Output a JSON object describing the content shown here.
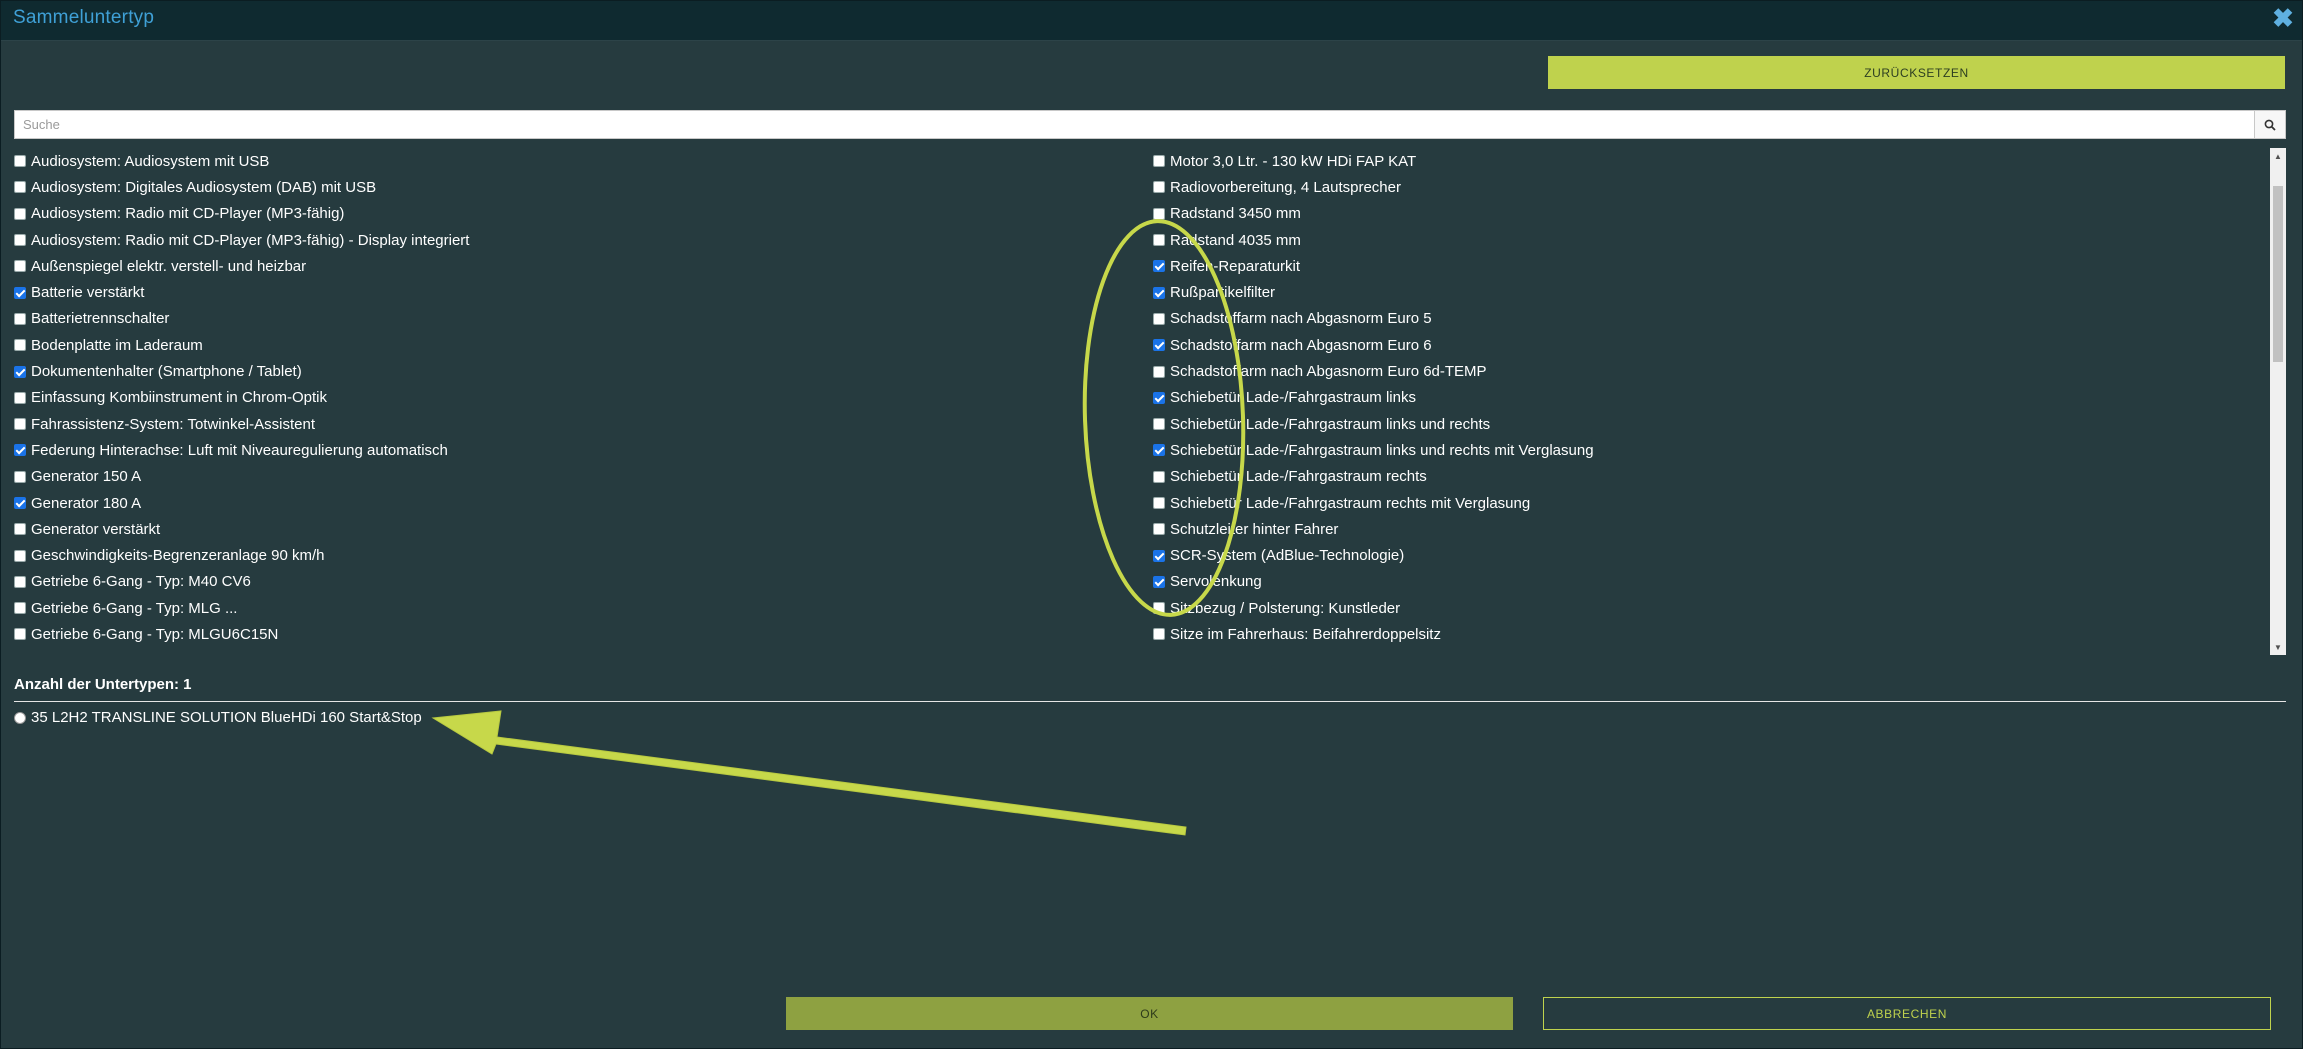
{
  "dialog": {
    "title": "Sammeluntertyp"
  },
  "toolbar": {
    "reset_label": "ZURÜCKSETZEN"
  },
  "search": {
    "placeholder": "Suche",
    "value": ""
  },
  "options_left": [
    {
      "label": "Audiosystem: Audiosystem mit USB",
      "checked": false
    },
    {
      "label": "Audiosystem: Digitales Audiosystem (DAB) mit USB",
      "checked": false
    },
    {
      "label": "Audiosystem: Radio mit CD-Player (MP3-fähig)",
      "checked": false
    },
    {
      "label": "Audiosystem: Radio mit CD-Player (MP3-fähig) - Display integriert",
      "checked": false
    },
    {
      "label": "Außenspiegel elektr. verstell- und heizbar",
      "checked": false
    },
    {
      "label": "Batterie verstärkt",
      "checked": true
    },
    {
      "label": "Batterietrennschalter",
      "checked": false
    },
    {
      "label": "Bodenplatte im Laderaum",
      "checked": false
    },
    {
      "label": "Dokumentenhalter (Smartphone / Tablet)",
      "checked": true
    },
    {
      "label": "Einfassung Kombiinstrument in Chrom-Optik",
      "checked": false
    },
    {
      "label": "Fahrassistenz-System: Totwinkel-Assistent",
      "checked": false
    },
    {
      "label": "Federung Hinterachse: Luft mit Niveauregulierung automatisch",
      "checked": true
    },
    {
      "label": "Generator 150 A",
      "checked": false
    },
    {
      "label": "Generator 180 A",
      "checked": true
    },
    {
      "label": "Generator verstärkt",
      "checked": false
    },
    {
      "label": "Geschwindigkeits-Begrenzeranlage 90 km/h",
      "checked": false
    },
    {
      "label": "Getriebe 6-Gang - Typ: M40 CV6",
      "checked": false
    },
    {
      "label": "Getriebe 6-Gang - Typ: MLG ...",
      "checked": false
    },
    {
      "label": "Getriebe 6-Gang - Typ: MLGU6C15N",
      "checked": false
    }
  ],
  "options_right": [
    {
      "label": "Motor 3,0 Ltr. - 130 kW HDi FAP KAT",
      "checked": false
    },
    {
      "label": "Radiovorbereitung, 4 Lautsprecher",
      "checked": false
    },
    {
      "label": "Radstand 3450 mm",
      "checked": false
    },
    {
      "label": "Radstand 4035 mm",
      "checked": false
    },
    {
      "label": "Reifen-Reparaturkit",
      "checked": true
    },
    {
      "label": "Rußpartikelfilter",
      "checked": true
    },
    {
      "label": "Schadstoffarm nach Abgasnorm Euro 5",
      "checked": false
    },
    {
      "label": "Schadstoffarm nach Abgasnorm Euro 6",
      "checked": true
    },
    {
      "label": "Schadstoffarm nach Abgasnorm Euro 6d-TEMP",
      "checked": false
    },
    {
      "label": "Schiebetür Lade-/Fahrgastraum links",
      "checked": true
    },
    {
      "label": "Schiebetür Lade-/Fahrgastraum links und rechts",
      "checked": false
    },
    {
      "label": "Schiebetür Lade-/Fahrgastraum links und rechts mit Verglasung",
      "checked": true
    },
    {
      "label": "Schiebetür Lade-/Fahrgastraum rechts",
      "checked": false
    },
    {
      "label": "Schiebetür Lade-/Fahrgastraum rechts mit Verglasung",
      "checked": false
    },
    {
      "label": "Schutzleiter hinter Fahrer",
      "checked": false
    },
    {
      "label": "SCR-System (AdBlue-Technologie)",
      "checked": true
    },
    {
      "label": "Servolenkung",
      "checked": true
    },
    {
      "label": "Sitzbezug / Polsterung: Kunstleder",
      "checked": false
    },
    {
      "label": "Sitze im Fahrerhaus: Beifahrerdoppelsitz",
      "checked": false
    }
  ],
  "subtypes": {
    "count_label": "Anzahl der Untertypen: 1",
    "items": [
      {
        "label": "35 L2H2 TRANSLINE SOLUTION BlueHDi 160 Start&Stop",
        "selected": false
      }
    ]
  },
  "footer": {
    "ok_label": "OK",
    "cancel_label": "ABBRECHEN"
  },
  "colors": {
    "background": "#263b3f",
    "titlebar": "#0f2a30",
    "accent": "#bfd24d",
    "ok_button": "#8ea141",
    "checkbox_checked": "#1a73e8",
    "annotation": "#c7d84a"
  },
  "icons": {
    "close": "close-icon",
    "search": "search-icon",
    "scroll_up": "chevron-up-icon",
    "scroll_down": "chevron-down-icon"
  }
}
